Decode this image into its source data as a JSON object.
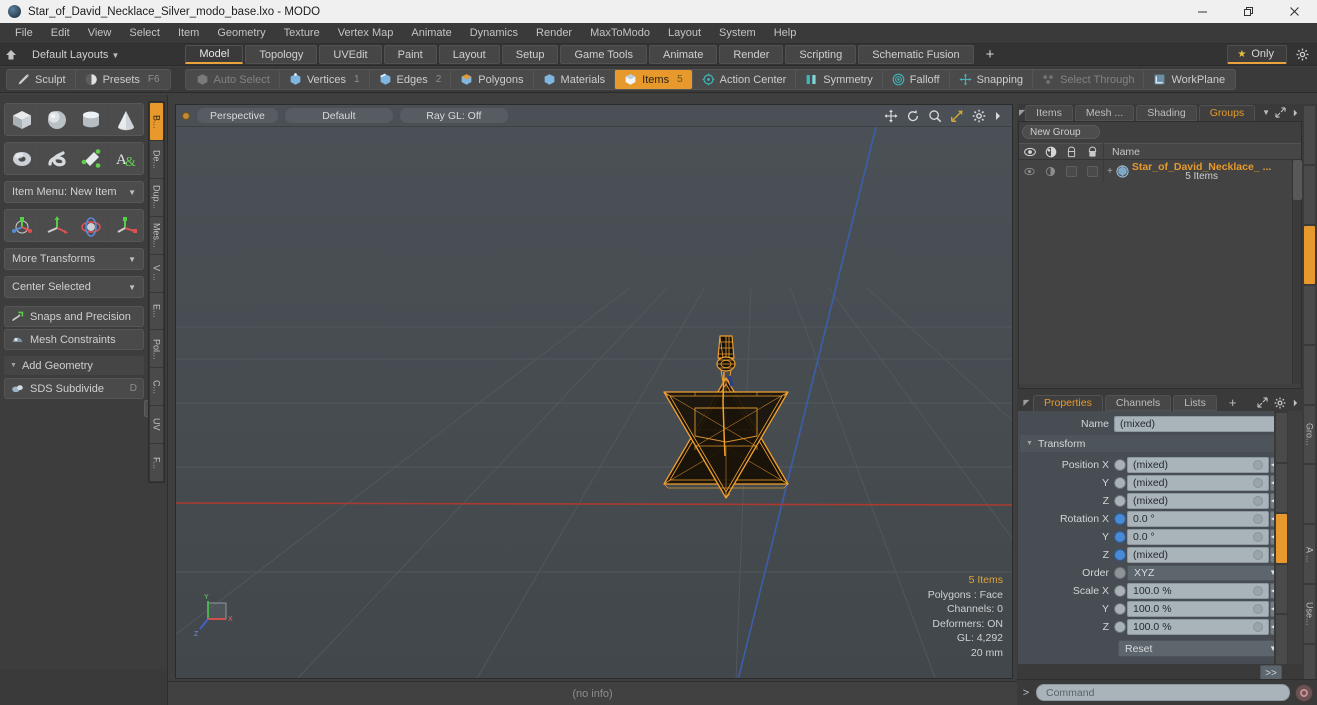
{
  "window": {
    "title": "Star_of_David_Necklace_Silver_modo_base.lxo - MODO",
    "app_icon": "modo-sphere-icon",
    "controls": {
      "minimize": "minimize-icon",
      "maximize": "restore-icon",
      "close": "close-icon"
    }
  },
  "menubar": {
    "items": [
      "File",
      "Edit",
      "View",
      "Select",
      "Item",
      "Geometry",
      "Texture",
      "Vertex Map",
      "Animate",
      "Dynamics",
      "Render",
      "MaxToModo",
      "Layout",
      "System",
      "Help"
    ]
  },
  "layoutrow": {
    "home_icon": "home-icon",
    "layouts_label": "Default Layouts",
    "tabs": [
      {
        "label": "Model",
        "active": true
      },
      {
        "label": "Topology",
        "active": false
      },
      {
        "label": "UVEdit",
        "active": false
      },
      {
        "label": "Paint",
        "active": false
      },
      {
        "label": "Layout",
        "active": false
      },
      {
        "label": "Setup",
        "active": false
      },
      {
        "label": "Game Tools",
        "active": false
      },
      {
        "label": "Animate",
        "active": false
      },
      {
        "label": "Render",
        "active": false
      },
      {
        "label": "Scripting",
        "active": false
      },
      {
        "label": "Schematic Fusion",
        "active": false
      }
    ],
    "add_tab_label": "+",
    "only_label": "Only",
    "only_icon": "star-icon",
    "gear_icon": "gear-icon"
  },
  "modebar": {
    "group_left": [
      {
        "label": "Sculpt",
        "icon": "brush-icon",
        "state": "normal",
        "count": ""
      },
      {
        "label": "Presets",
        "icon": "sphere-icon",
        "state": "normal",
        "count": "F6"
      }
    ],
    "group_select": [
      {
        "label": "Auto Select",
        "icon": "cube-gray-icon",
        "state": "dim",
        "count": ""
      },
      {
        "label": "Vertices",
        "icon": "vertex-icon",
        "state": "normal",
        "count": "1"
      },
      {
        "label": "Edges",
        "icon": "edge-icon",
        "state": "normal",
        "count": "2"
      },
      {
        "label": "Polygons",
        "icon": "polygon-icon",
        "state": "normal",
        "count": ""
      },
      {
        "label": "Materials",
        "icon": "material-icon",
        "state": "normal",
        "count": ""
      },
      {
        "label": "Items",
        "icon": "items-icon",
        "state": "selected",
        "count": "5"
      },
      {
        "label": "Action Center",
        "icon": "action-center-icon",
        "state": "normal",
        "count": ""
      },
      {
        "label": "Symmetry",
        "icon": "symmetry-icon",
        "state": "normal",
        "count": ""
      },
      {
        "label": "Falloff",
        "icon": "falloff-icon",
        "state": "normal",
        "count": ""
      },
      {
        "label": "Snapping",
        "icon": "snapping-icon",
        "state": "normal",
        "count": ""
      },
      {
        "label": "Select Through",
        "icon": "select-through-icon",
        "state": "dim",
        "count": ""
      },
      {
        "label": "WorkPlane",
        "icon": "workplane-icon",
        "state": "normal",
        "count": ""
      }
    ]
  },
  "toolbox": {
    "primitives_row1": [
      {
        "name": "cube-tool",
        "icon": "cube-icon"
      },
      {
        "name": "sphere-tool",
        "icon": "sphere-icon"
      },
      {
        "name": "cylinder-tool",
        "icon": "cylinder-icon"
      },
      {
        "name": "cone-tool",
        "icon": "cone-icon"
      }
    ],
    "primitives_row2": [
      {
        "name": "torus-tool",
        "icon": "torus-icon"
      },
      {
        "name": "spiral-tool",
        "icon": "spiral-icon"
      },
      {
        "name": "pen-tool",
        "icon": "pen-green-icon"
      },
      {
        "name": "text-tool",
        "icon": "text-a-icon"
      }
    ],
    "item_menu": "Item Menu: New Item",
    "transforms_row": [
      {
        "name": "transform-tool",
        "icon": "transform-icon"
      },
      {
        "name": "move-tool",
        "icon": "move-icon"
      },
      {
        "name": "rotate-tool",
        "icon": "rotate-icon"
      },
      {
        "name": "scale-tool",
        "icon": "scale-icon"
      }
    ],
    "more_transforms": "More Transforms",
    "center_selected": "Center Selected",
    "snaps_and_precision": {
      "label": "Snaps and Precision",
      "icon": "snap-magnet-icon",
      "shortcut": ""
    },
    "mesh_constraints": {
      "label": "Mesh Constraints",
      "icon": "mesh-constraint-icon",
      "shortcut": ""
    },
    "add_geometry": "Add Geometry",
    "sds_subdivide": {
      "label": "SDS Subdivide",
      "icon": "sds-icon",
      "shortcut": "D"
    },
    "advanced_button": ">>",
    "vtabs": [
      {
        "label": "B...",
        "active": true
      },
      {
        "label": "De...",
        "active": false
      },
      {
        "label": "Dup...",
        "active": false
      },
      {
        "label": "Mes...",
        "active": false
      },
      {
        "label": "V ...",
        "active": false
      },
      {
        "label": "E...",
        "active": false
      },
      {
        "label": "Pol...",
        "active": false
      },
      {
        "label": "C...",
        "active": false
      },
      {
        "label": "UV",
        "active": false
      },
      {
        "label": "F...",
        "active": false
      }
    ]
  },
  "viewport": {
    "view_mode": "Perspective",
    "shading_mode": "Default",
    "raygl": "Ray GL: Off",
    "icons": [
      "pan-icon",
      "rotate-view-icon",
      "zoom-icon",
      "fit-icon",
      "viewport-settings-icon",
      "viewport-more-icon"
    ],
    "gizmo": {
      "x": "X",
      "y": "Y",
      "z": "Z"
    },
    "info": {
      "items": "5 Items",
      "polygons": "Polygons : Face",
      "channels": "Channels: 0",
      "deformers": "Deformers: ON",
      "gl": "GL: 4,292",
      "scale": "20 mm"
    },
    "status": "(no info)"
  },
  "right": {
    "top_tabs": [
      {
        "label": "Items",
        "active": false
      },
      {
        "label": "Mesh ...",
        "active": false
      },
      {
        "label": "Shading",
        "active": false
      },
      {
        "label": "Groups",
        "active": true
      }
    ],
    "top_tab_icons": [
      "expand-icon",
      "panel-more-icon"
    ],
    "new_group_label": "New Group",
    "tree_columns": [
      "eye-icon",
      "render-icon",
      "lock-icon",
      "select-icon"
    ],
    "tree_name_header": "Name",
    "tree_rows": [
      {
        "icon": "group-item-icon",
        "name": "Star_of_David_Necklace_ ...",
        "subtitle": "5 Items",
        "expander": "+"
      }
    ],
    "props_tabs": [
      {
        "label": "Properties",
        "active": true
      },
      {
        "label": "Channels",
        "active": false
      },
      {
        "label": "Lists",
        "active": false
      },
      {
        "label": "+",
        "active": false
      }
    ],
    "props_tab_icons": [
      "expand-icon",
      "gear-icon",
      "panel-more-icon"
    ],
    "name_label": "Name",
    "name_value": "(mixed)",
    "transform_section": "Transform",
    "transform_rows": [
      {
        "label": "Position X",
        "value": "(mixed)",
        "radio": "gray"
      },
      {
        "label": "Y",
        "value": "(mixed)",
        "radio": "gray"
      },
      {
        "label": "Z",
        "value": "(mixed)",
        "radio": "gray"
      },
      {
        "label": "Rotation X",
        "value": "0.0 °",
        "radio": "blue"
      },
      {
        "label": "Y",
        "value": "0.0 °",
        "radio": "blue"
      },
      {
        "label": "Z",
        "value": "(mixed)",
        "radio": "blue"
      }
    ],
    "order_label": "Order",
    "order_value": "XYZ",
    "scale_rows": [
      {
        "label": "Scale X",
        "value": "100.0 %",
        "radio": "gray"
      },
      {
        "label": "Y",
        "value": "100.0 %",
        "radio": "gray"
      },
      {
        "label": "Z",
        "value": "100.0 %",
        "radio": "gray"
      }
    ],
    "reset_label": "Reset",
    "advanced_button": ">>",
    "vtabs": [
      {
        "label": "",
        "active": false
      },
      {
        "label": "",
        "active": false
      },
      {
        "label": "",
        "active": true
      },
      {
        "label": "",
        "active": false
      },
      {
        "label": "",
        "active": false
      },
      {
        "label": "Gro...",
        "active": false
      },
      {
        "label": "",
        "active": false
      },
      {
        "label": "A ...",
        "active": false
      },
      {
        "label": "Use...",
        "active": false
      },
      {
        "label": "",
        "active": false
      }
    ]
  },
  "command": {
    "prompt": ">",
    "placeholder": "Command",
    "record_icon": "record-icon"
  },
  "colors": {
    "accent": "#e79a2b",
    "panel_bg": "#3a3a3a",
    "viewport_bg": "#454b4f",
    "model_wire": "#f0a030",
    "x_axis": "#c0392b",
    "z_axis": "#2b50c0"
  }
}
